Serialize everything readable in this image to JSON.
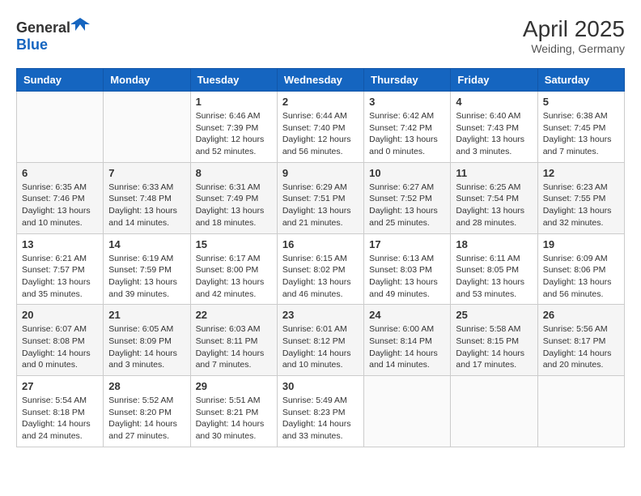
{
  "header": {
    "logo_general": "General",
    "logo_blue": "Blue",
    "month_year": "April 2025",
    "location": "Weiding, Germany"
  },
  "weekdays": [
    "Sunday",
    "Monday",
    "Tuesday",
    "Wednesday",
    "Thursday",
    "Friday",
    "Saturday"
  ],
  "weeks": [
    [
      {
        "day": "",
        "info": ""
      },
      {
        "day": "",
        "info": ""
      },
      {
        "day": "1",
        "info": "Sunrise: 6:46 AM\nSunset: 7:39 PM\nDaylight: 12 hours and 52 minutes."
      },
      {
        "day": "2",
        "info": "Sunrise: 6:44 AM\nSunset: 7:40 PM\nDaylight: 12 hours and 56 minutes."
      },
      {
        "day": "3",
        "info": "Sunrise: 6:42 AM\nSunset: 7:42 PM\nDaylight: 13 hours and 0 minutes."
      },
      {
        "day": "4",
        "info": "Sunrise: 6:40 AM\nSunset: 7:43 PM\nDaylight: 13 hours and 3 minutes."
      },
      {
        "day": "5",
        "info": "Sunrise: 6:38 AM\nSunset: 7:45 PM\nDaylight: 13 hours and 7 minutes."
      }
    ],
    [
      {
        "day": "6",
        "info": "Sunrise: 6:35 AM\nSunset: 7:46 PM\nDaylight: 13 hours and 10 minutes."
      },
      {
        "day": "7",
        "info": "Sunrise: 6:33 AM\nSunset: 7:48 PM\nDaylight: 13 hours and 14 minutes."
      },
      {
        "day": "8",
        "info": "Sunrise: 6:31 AM\nSunset: 7:49 PM\nDaylight: 13 hours and 18 minutes."
      },
      {
        "day": "9",
        "info": "Sunrise: 6:29 AM\nSunset: 7:51 PM\nDaylight: 13 hours and 21 minutes."
      },
      {
        "day": "10",
        "info": "Sunrise: 6:27 AM\nSunset: 7:52 PM\nDaylight: 13 hours and 25 minutes."
      },
      {
        "day": "11",
        "info": "Sunrise: 6:25 AM\nSunset: 7:54 PM\nDaylight: 13 hours and 28 minutes."
      },
      {
        "day": "12",
        "info": "Sunrise: 6:23 AM\nSunset: 7:55 PM\nDaylight: 13 hours and 32 minutes."
      }
    ],
    [
      {
        "day": "13",
        "info": "Sunrise: 6:21 AM\nSunset: 7:57 PM\nDaylight: 13 hours and 35 minutes."
      },
      {
        "day": "14",
        "info": "Sunrise: 6:19 AM\nSunset: 7:59 PM\nDaylight: 13 hours and 39 minutes."
      },
      {
        "day": "15",
        "info": "Sunrise: 6:17 AM\nSunset: 8:00 PM\nDaylight: 13 hours and 42 minutes."
      },
      {
        "day": "16",
        "info": "Sunrise: 6:15 AM\nSunset: 8:02 PM\nDaylight: 13 hours and 46 minutes."
      },
      {
        "day": "17",
        "info": "Sunrise: 6:13 AM\nSunset: 8:03 PM\nDaylight: 13 hours and 49 minutes."
      },
      {
        "day": "18",
        "info": "Sunrise: 6:11 AM\nSunset: 8:05 PM\nDaylight: 13 hours and 53 minutes."
      },
      {
        "day": "19",
        "info": "Sunrise: 6:09 AM\nSunset: 8:06 PM\nDaylight: 13 hours and 56 minutes."
      }
    ],
    [
      {
        "day": "20",
        "info": "Sunrise: 6:07 AM\nSunset: 8:08 PM\nDaylight: 14 hours and 0 minutes."
      },
      {
        "day": "21",
        "info": "Sunrise: 6:05 AM\nSunset: 8:09 PM\nDaylight: 14 hours and 3 minutes."
      },
      {
        "day": "22",
        "info": "Sunrise: 6:03 AM\nSunset: 8:11 PM\nDaylight: 14 hours and 7 minutes."
      },
      {
        "day": "23",
        "info": "Sunrise: 6:01 AM\nSunset: 8:12 PM\nDaylight: 14 hours and 10 minutes."
      },
      {
        "day": "24",
        "info": "Sunrise: 6:00 AM\nSunset: 8:14 PM\nDaylight: 14 hours and 14 minutes."
      },
      {
        "day": "25",
        "info": "Sunrise: 5:58 AM\nSunset: 8:15 PM\nDaylight: 14 hours and 17 minutes."
      },
      {
        "day": "26",
        "info": "Sunrise: 5:56 AM\nSunset: 8:17 PM\nDaylight: 14 hours and 20 minutes."
      }
    ],
    [
      {
        "day": "27",
        "info": "Sunrise: 5:54 AM\nSunset: 8:18 PM\nDaylight: 14 hours and 24 minutes."
      },
      {
        "day": "28",
        "info": "Sunrise: 5:52 AM\nSunset: 8:20 PM\nDaylight: 14 hours and 27 minutes."
      },
      {
        "day": "29",
        "info": "Sunrise: 5:51 AM\nSunset: 8:21 PM\nDaylight: 14 hours and 30 minutes."
      },
      {
        "day": "30",
        "info": "Sunrise: 5:49 AM\nSunset: 8:23 PM\nDaylight: 14 hours and 33 minutes."
      },
      {
        "day": "",
        "info": ""
      },
      {
        "day": "",
        "info": ""
      },
      {
        "day": "",
        "info": ""
      }
    ]
  ]
}
